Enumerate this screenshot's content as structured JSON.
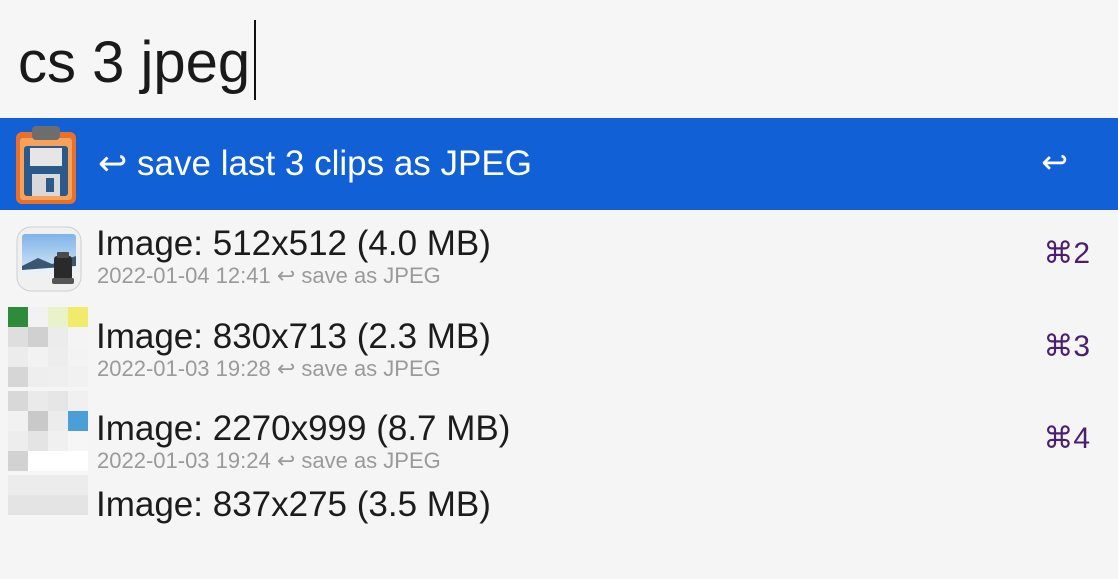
{
  "search": {
    "query": "cs 3 jpeg"
  },
  "results": [
    {
      "icon": "clipboard-floppy-icon",
      "title": "↩ save last 3 clips as JPEG",
      "subtitle": "",
      "shortcut": "↩",
      "selected": true
    },
    {
      "icon": "preview-app-icon",
      "title": "Image: 512x512 (4.0 MB)",
      "subtitle": "2022-01-04 12:41 ↩ save as JPEG",
      "shortcut": "⌘2",
      "selected": false
    },
    {
      "icon": "image-thumbnail-icon",
      "title": "Image: 830x713 (2.3 MB)",
      "subtitle": "2022-01-03 19:28 ↩ save as JPEG",
      "shortcut": "⌘3",
      "selected": false
    },
    {
      "icon": "image-thumbnail-icon",
      "title": "Image: 2270x999 (8.7 MB)",
      "subtitle": "2022-01-03 19:24 ↩ save as JPEG",
      "shortcut": "⌘4",
      "selected": false
    },
    {
      "icon": "image-thumbnail-icon",
      "title": "Image: 837x275 (3.5 MB)",
      "subtitle": "",
      "shortcut": "",
      "selected": false
    }
  ],
  "colors": {
    "selection": "#1160d6",
    "shortcut": "#4a1f72"
  }
}
